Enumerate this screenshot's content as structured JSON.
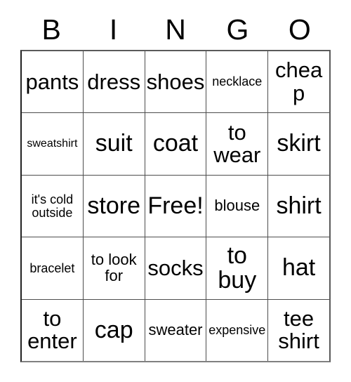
{
  "card": {
    "title": "BINGO",
    "header_letters": [
      "B",
      "I",
      "N",
      "G",
      "O"
    ],
    "colors": {
      "background": "#ffffff",
      "text": "#000000",
      "grid_line": "#4d4d4d",
      "grid_border": "#222222"
    },
    "free_space": {
      "row": 3,
      "column": 3,
      "label": "Free!"
    },
    "rows": [
      [
        {
          "text": "pants",
          "size": "lg",
          "lines": 1
        },
        {
          "text": "dress",
          "size": "lg",
          "lines": 1
        },
        {
          "text": "shoes",
          "size": "lg",
          "lines": 1
        },
        {
          "text": "necklace",
          "size": "sm",
          "lines": 1
        },
        {
          "text": "cheap",
          "size": "lg",
          "lines": 1
        }
      ],
      [
        {
          "text": "sweatshirt",
          "size": "xs",
          "lines": 1
        },
        {
          "text": "suit",
          "size": "xl",
          "lines": 1
        },
        {
          "text": "coat",
          "size": "xl",
          "lines": 1
        },
        {
          "text": "to\nwear",
          "size": "lg",
          "lines": 2
        },
        {
          "text": "skirt",
          "size": "xl",
          "lines": 1
        }
      ],
      [
        {
          "text": "it's cold\noutside",
          "size": "sm",
          "lines": 2
        },
        {
          "text": "store",
          "size": "xl",
          "lines": 1
        },
        {
          "text": "Free!",
          "size": "xl",
          "lines": 1
        },
        {
          "text": "blouse",
          "size": "md",
          "lines": 1
        },
        {
          "text": "shirt",
          "size": "xl",
          "lines": 1
        }
      ],
      [
        {
          "text": "bracelet",
          "size": "sm",
          "lines": 1
        },
        {
          "text": "to look\nfor",
          "size": "md",
          "lines": 2
        },
        {
          "text": "socks",
          "size": "lg",
          "lines": 1
        },
        {
          "text": "to\nbuy",
          "size": "xl",
          "lines": 2
        },
        {
          "text": "hat",
          "size": "xl",
          "lines": 1
        }
      ],
      [
        {
          "text": "to\nenter",
          "size": "lg",
          "lines": 2
        },
        {
          "text": "cap",
          "size": "xl",
          "lines": 1
        },
        {
          "text": "sweater",
          "size": "md",
          "lines": 1
        },
        {
          "text": "expensive",
          "size": "sm",
          "lines": 1
        },
        {
          "text": "tee\nshirt",
          "size": "lg",
          "lines": 2
        }
      ]
    ]
  }
}
